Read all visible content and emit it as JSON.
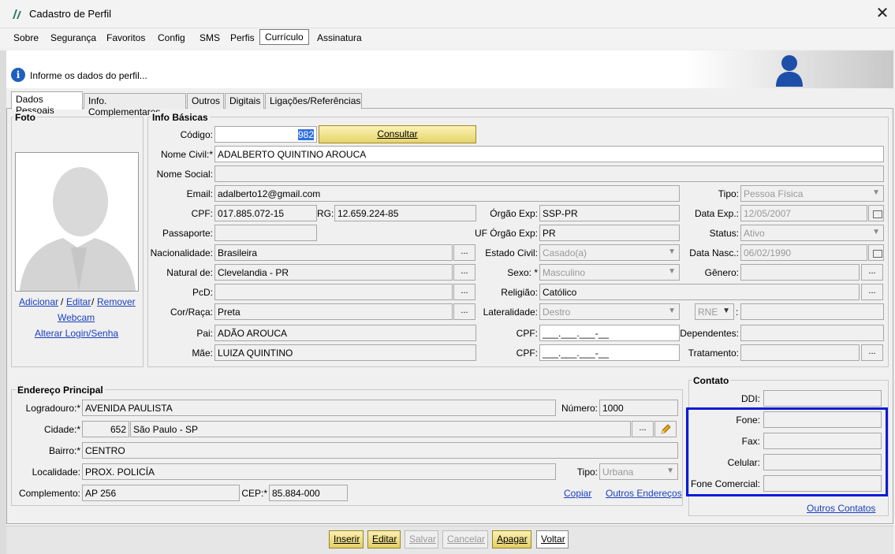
{
  "window": {
    "title": "Cadastro de Perfil",
    "close_glyph": "✕"
  },
  "menu": [
    "Sobre",
    "Segurança",
    "Favoritos",
    "Config",
    "SMS",
    "Perfis",
    "Currículo",
    "Assinatura"
  ],
  "header": {
    "info_text": "Informe os dados do perfil..."
  },
  "tabs": [
    "Dados Pessoais",
    "Info. Complementares",
    "Outros",
    "Digitais",
    "Ligações/Referências"
  ],
  "foto": {
    "title": "Foto",
    "adicionar": "Adicionar",
    "editar": "Editar",
    "remover": "Remover",
    "sep": "/",
    "webcam": "Webcam",
    "alterar_login": "Alterar Login/Senha"
  },
  "info_basicas": {
    "title": "Info Básicas",
    "codigo_label": "Código:",
    "codigo_value": "982",
    "consultar": "Consultar",
    "nome_civil_label": "Nome Civil:*",
    "nome_civil": "ADALBERTO QUINTINO AROUCA",
    "nome_social_label": "Nome Social:",
    "email_label": "Email:",
    "email": "adalberto12@gmail.com",
    "tipo_label": "Tipo:",
    "tipo": "Pessoa Física",
    "cpf_label": "CPF:",
    "cpf": "017.885.072-15",
    "rg_label": "RG:",
    "rg": "12.659.224-85",
    "orgao_label": "Órgão Exp:",
    "orgao": "SSP-PR",
    "data_exp_label": "Data Exp.:",
    "data_exp": "12/05/2007",
    "passaporte_label": "Passaporte:",
    "uf_orgao_label": "UF Órgão Exp:",
    "uf_orgao": "PR",
    "status_label": "Status:",
    "status": "Ativo",
    "nacionalidade_label": "Nacionalidade:",
    "nacionalidade": "Brasileira",
    "estado_civil_label": "Estado Civil:",
    "estado_civil": "Casado(a)",
    "data_nasc_label": "Data Nasc.:",
    "data_nasc": "06/02/1990",
    "natural_label": "Natural de:",
    "natural": "Clevelandia - PR",
    "sexo_label": "Sexo: *",
    "sexo": "Masculino",
    "genero_label": "Gênero:",
    "pcd_label": "PcD:",
    "religiao_label": "Religião:",
    "religiao": "Católico",
    "cor_label": "Cor/Raça:",
    "cor": "Preta",
    "lateralidade_label": "Lateralidade:",
    "lateralidade": "Destro",
    "rne": "RNE",
    "rne_colon": ":",
    "pai_label": "Pai:",
    "pai": "ADÃO AROUCA",
    "cpf_pai_label": "CPF:",
    "cpf_mask": "___.___.___-__",
    "dependentes_label": "Dependentes:",
    "mae_label": "Mãe:",
    "mae": "LUIZA QUINTINO",
    "cpf_mae_label": "CPF:",
    "tratamento_label": "Tratamento:",
    "dots": "..."
  },
  "endereco": {
    "title": "Endereço Principal",
    "logradouro_label": "Logradouro:*",
    "logradouro": "AVENIDA PAULISTA",
    "numero_label": "Número:",
    "numero": "1000",
    "cidade_label": "Cidade:*",
    "cidade_code": "652",
    "cidade": "São Paulo - SP",
    "bairro_label": "Bairro:*",
    "bairro": "CENTRO",
    "localidade_label": "Localidade:",
    "localidade": "PROX. POLICÍA",
    "tipo_label": "Tipo:",
    "tipo": "Urbana",
    "complemento_label": "Complemento:",
    "complemento": "AP 256",
    "cep_label": "CEP:*",
    "cep": "85.884-000",
    "copiar": "Copiar",
    "outros_enderecos": "Outros Endereços"
  },
  "contato": {
    "title": "Contato",
    "ddi_label": "DDI:",
    "fone_label": "Fone:",
    "fax_label": "Fax:",
    "celular_label": "Celular:",
    "fone_comercial_label": "Fone Comercial:",
    "outros_contatos": "Outros Contatos"
  },
  "buttons": {
    "inserir": "Inserir",
    "editar": "Editar",
    "salvar": "Salvar",
    "cancelar": "Cancelar",
    "apagar": "Apagar",
    "voltar": "Voltar"
  },
  "colors": {
    "highlight": "#0a1ad8",
    "link": "#1a3fbf",
    "info": "#1f5fbf",
    "avatar": "#1d4fa8"
  }
}
